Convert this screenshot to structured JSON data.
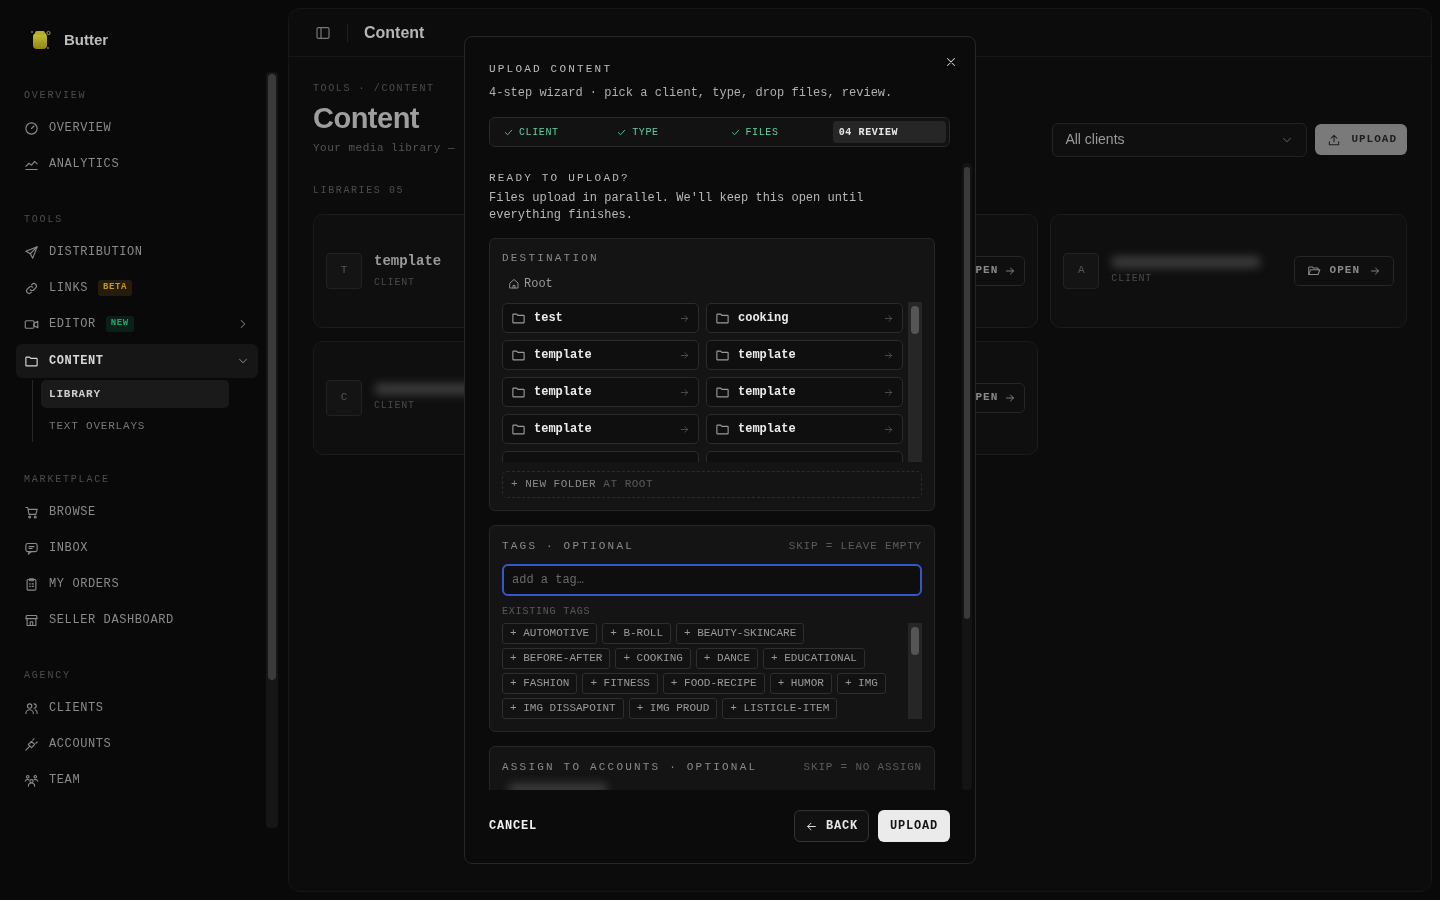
{
  "sidebar": {
    "brand": "Butter",
    "sections": [
      {
        "title": "OVERVIEW",
        "items": [
          {
            "label": "OVERVIEW",
            "selected": false
          },
          {
            "label": "ANALYTICS",
            "selected": false
          }
        ]
      },
      {
        "title": "TOOLS",
        "items": [
          {
            "label": "DISTRIBUTION",
            "selected": false
          },
          {
            "label": "LINKS",
            "selected": false,
            "badge": {
              "text": "BETA",
              "color": "#c8961e"
            }
          },
          {
            "label": "EDITOR",
            "selected": false,
            "badge": {
              "text": "NEW",
              "color": "#1fa870"
            },
            "expanded": false
          },
          {
            "label": "CONTENT",
            "selected": true,
            "expanded": true,
            "children": [
              {
                "label": "LIBRARY",
                "selected": true
              },
              {
                "label": "TEXT OVERLAYS",
                "selected": false
              }
            ]
          }
        ]
      },
      {
        "title": "MARKETPLACE",
        "items": [
          {
            "label": "BROWSE",
            "selected": false
          },
          {
            "label": "INBOX",
            "selected": false
          },
          {
            "label": "MY ORDERS",
            "selected": false
          },
          {
            "label": "SELLER DASHBOARD",
            "selected": false
          }
        ]
      },
      {
        "title": "AGENCY",
        "items": [
          {
            "label": "CLIENTS",
            "selected": false
          },
          {
            "label": "ACCOUNTS",
            "selected": false
          },
          {
            "label": "TEAM",
            "selected": false
          }
        ]
      }
    ]
  },
  "topbar": {
    "title": "Content"
  },
  "page": {
    "breadcrumb": "TOOLS · /CONTENT",
    "heading": "Content",
    "subtitle": "Your media library —",
    "client_filter": {
      "value": "All clients"
    },
    "upload_button": "UPLOAD",
    "libraries_label": "LIBRARIES 05",
    "cards": [
      {
        "initial": "T",
        "name": "template",
        "subtitle": "CLIENT"
      },
      {
        "open": "PEN",
        "cut": true
      },
      {
        "initial": "A",
        "redacted": true,
        "subtitle": "CLIENT",
        "open": "OPEN",
        "cut": false
      },
      {
        "initial": "C",
        "redacted": true,
        "subtitle": "CLIENT"
      },
      {
        "open": "PEN",
        "cut": true
      }
    ]
  },
  "dialog": {
    "title": "UPLOAD CONTENT",
    "subtitle": "4-step wizard · pick a client, type, drop files, review.",
    "steps": [
      {
        "label": "CLIENT",
        "done": true,
        "selected": false
      },
      {
        "label": "TYPE",
        "done": true,
        "selected": false
      },
      {
        "label": "FILES",
        "done": true,
        "selected": false
      },
      {
        "label": "04 REVIEW",
        "done": false,
        "selected": true
      }
    ],
    "heading": "READY TO UPLOAD?",
    "description": "Files upload in parallel. We'll keep this open until everything finishes.",
    "destination": {
      "title": "DESTINATION",
      "breadcrumb": "Root",
      "folders": [
        {
          "name": "test"
        },
        {
          "name": "cooking"
        },
        {
          "name": "template"
        },
        {
          "name": "template"
        },
        {
          "name": "template"
        },
        {
          "name": "template"
        },
        {
          "name": "template"
        },
        {
          "name": "template"
        },
        {
          "partial": true
        },
        {
          "partial": true
        }
      ],
      "new_folder": {
        "label": "+ NEW FOLDER",
        "suffix": "AT ROOT"
      }
    },
    "tags": {
      "title": "TAGS · OPTIONAL",
      "hint": "SKIP = LEAVE EMPTY",
      "placeholder": "add a tag…",
      "existing_title": "EXISTING TAGS",
      "existing": [
        "+ AUTOMOTIVE",
        "+ B-ROLL",
        "+ BEAUTY-SKINCARE",
        "+ BEFORE-AFTER",
        "+ COOKING",
        "+ DANCE",
        "+ EDUCATIONAL",
        "+ FASHION",
        "+ FITNESS",
        "+ FOOD-RECIPE",
        "+ HUMOR",
        "+ IMG",
        "+ IMG DISSAPOINT",
        "+ IMG PROUD",
        "+ LISTICLE-ITEM"
      ]
    },
    "assign": {
      "title": "ASSIGN TO ACCOUNTS · OPTIONAL",
      "hint": "SKIP = NO ASSIGN",
      "redacted": true
    },
    "footer": {
      "cancel": "CANCEL",
      "back": "BACK",
      "upload": "UPLOAD"
    }
  }
}
